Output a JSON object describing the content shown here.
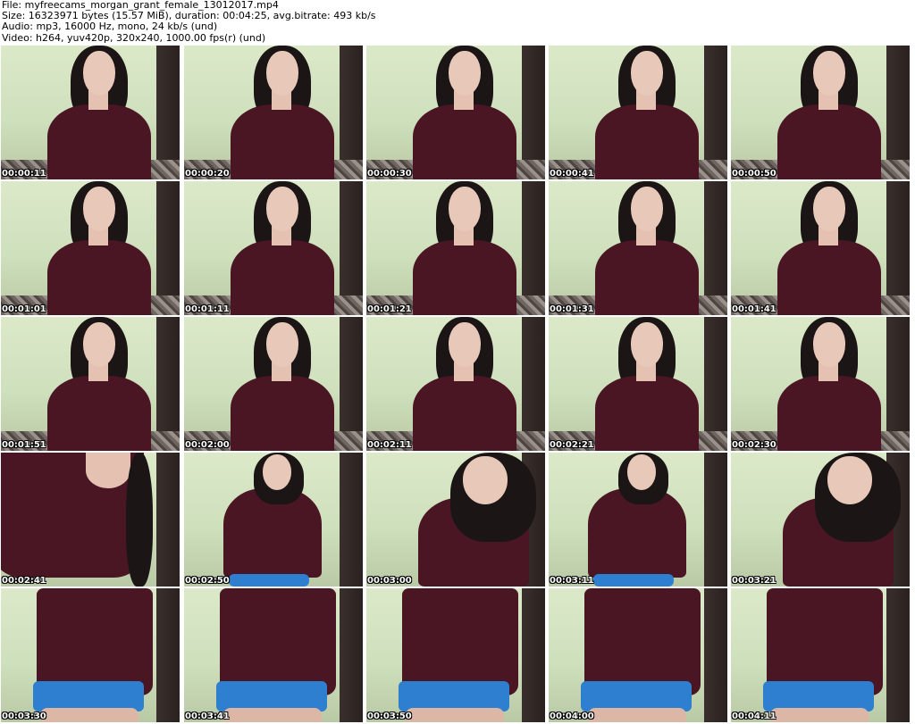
{
  "header": {
    "file_line": "File: myfreecams_morgan_grant_female_13012017.mp4",
    "size_line": "Size: 16323971 bytes (15.57 MiB), duration: 00:04:25, avg.bitrate: 493 kb/s",
    "audio_line": "Audio: mp3, 16000 Hz, mono, 24 kb/s (und)",
    "video_line": "Video: h264, yuv420p, 320x240, 1000.00 fps(r) (und)"
  },
  "thumbnails": [
    {
      "time": "00:00:11",
      "pose": "seated"
    },
    {
      "time": "00:00:20",
      "pose": "seated"
    },
    {
      "time": "00:00:30",
      "pose": "seated"
    },
    {
      "time": "00:00:41",
      "pose": "seated"
    },
    {
      "time": "00:00:50",
      "pose": "seated"
    },
    {
      "time": "00:01:01",
      "pose": "seated"
    },
    {
      "time": "00:01:11",
      "pose": "seated"
    },
    {
      "time": "00:01:21",
      "pose": "seated"
    },
    {
      "time": "00:01:31",
      "pose": "seated"
    },
    {
      "time": "00:01:41",
      "pose": "seated"
    },
    {
      "time": "00:01:51",
      "pose": "seated"
    },
    {
      "time": "00:02:00",
      "pose": "seated"
    },
    {
      "time": "00:02:11",
      "pose": "seated"
    },
    {
      "time": "00:02:21",
      "pose": "seated"
    },
    {
      "time": "00:02:30",
      "pose": "seated"
    },
    {
      "time": "00:02:41",
      "pose": "closeup"
    },
    {
      "time": "00:02:50",
      "pose": "standing"
    },
    {
      "time": "00:03:00",
      "pose": "leaning"
    },
    {
      "time": "00:03:11",
      "pose": "standing"
    },
    {
      "time": "00:03:21",
      "pose": "leaning"
    },
    {
      "time": "00:03:30",
      "pose": "torso"
    },
    {
      "time": "00:03:41",
      "pose": "torso"
    },
    {
      "time": "00:03:50",
      "pose": "torso"
    },
    {
      "time": "00:04:00",
      "pose": "torso"
    },
    {
      "time": "00:04:11",
      "pose": "torso"
    }
  ],
  "colors": {
    "wall": "#dbe9c8",
    "shirt": "#4a1624",
    "hair": "#1c1515",
    "shorts": "#2f7fd0",
    "timestamp_text": "#ffffff"
  }
}
